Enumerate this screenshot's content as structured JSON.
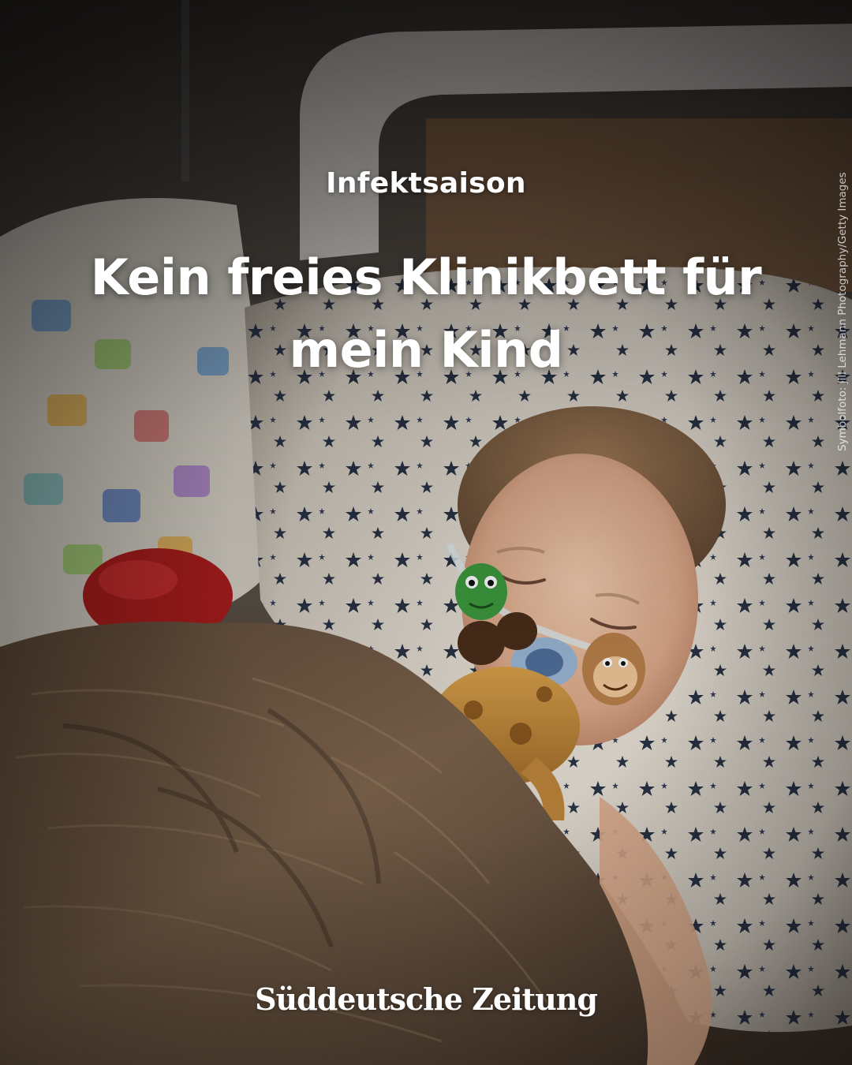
{
  "post": {
    "kicker": "Infektsaison",
    "headline_line1": "Kein freies Klinikbett für",
    "headline_line2": "mein Kind",
    "photo_credit": "Symbolfoto: Jill Lehmann Photography/Getty Images",
    "logo_text": "Süddeutsche Zeitung"
  },
  "icons": {
    "photo": "sleeping-child-hospital-photo"
  },
  "colors": {
    "text": "#ffffff",
    "blanket": "#6e5640",
    "pillow": "#e8e2d8",
    "star_pattern": "#1f2a3e"
  }
}
